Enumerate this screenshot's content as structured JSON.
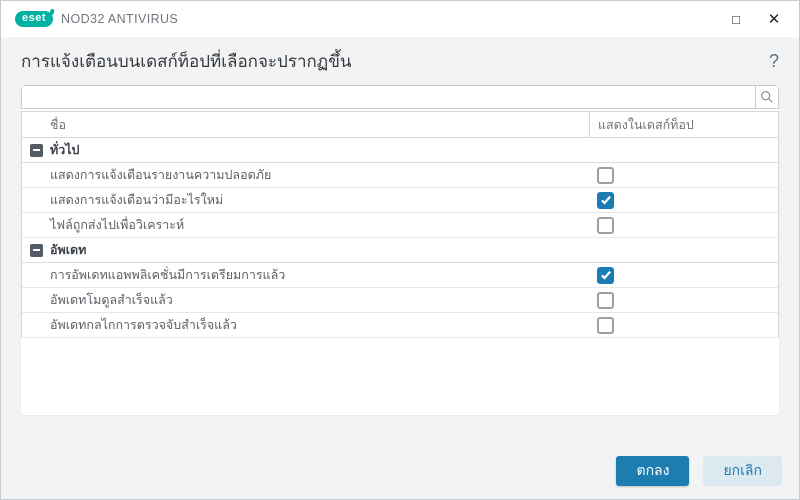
{
  "window": {
    "brand": "eset",
    "product": "NOD32 ANTIVIRUS",
    "controls": {
      "maximize": "□",
      "close": "✕"
    }
  },
  "header": {
    "title": "การแจ้งเตือนบนเดสก์ท็อปที่เลือกจะปรากฏขึ้น",
    "help": "?"
  },
  "search": {
    "value": "",
    "placeholder": "",
    "icon": "magnifier"
  },
  "table": {
    "columns": [
      {
        "label": "ชื่อ"
      },
      {
        "label": "แสดงในเดสก์ท็อป"
      }
    ],
    "groups": [
      {
        "label": "ทั่วไป",
        "collapsed": false,
        "rows": [
          {
            "label": "แสดงการแจ้งเตือนรายงานความปลอดภัย",
            "checked": false
          },
          {
            "label": "แสดงการแจ้งเตือนว่ามีอะไรใหม่",
            "checked": true
          },
          {
            "label": "ไฟล์ถูกส่งไปเพื่อวิเคราะห์",
            "checked": false
          }
        ]
      },
      {
        "label": "อัพเดท",
        "collapsed": false,
        "rows": [
          {
            "label": "การอัพเดทแอพพลิเคชั่นมีการเตรียมการแล้ว",
            "checked": true
          },
          {
            "label": "อัพเดทโมดูลสำเร็จแล้ว",
            "checked": false
          },
          {
            "label": "อัพเดทกลไกการตรวจจับสำเร็จแล้ว",
            "checked": false
          }
        ]
      }
    ]
  },
  "footer": {
    "ok_label": "ตกลง",
    "cancel_label": "ยกเลิก"
  },
  "colors": {
    "accent_teal": "#00b2a2",
    "primary_blue": "#1d7cb0",
    "checked_checkbox": "#1b7cb5",
    "cancel_button_bg": "#dde9f0",
    "page_bg": "#f1f3f5"
  }
}
